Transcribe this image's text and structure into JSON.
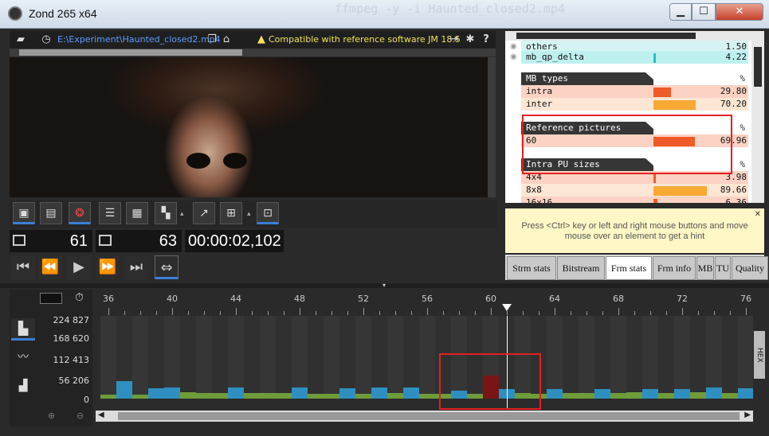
{
  "window": {
    "title": "Zond 265 x64",
    "min_label": "▁",
    "max_label": "☐",
    "close_label": "✕"
  },
  "background_code": "ffmpeg -y -i Haunted_closed2.mp4",
  "filebar": {
    "file_path": "E:\\Experiment\\Haunted_closed2.mp4",
    "compat_text": "Compatible with reference software JM 18.5"
  },
  "counters": {
    "current_frame": "61",
    "total_frames": "63",
    "timecode": "00:00:02,102"
  },
  "stats": {
    "top_rows": [
      {
        "label": "others",
        "value": "1.50"
      },
      {
        "label": "mb_qp_delta",
        "value": "4.22"
      }
    ],
    "sections": [
      {
        "title": "MB types",
        "pct": "%",
        "rows": [
          {
            "label": "intra",
            "value": "29.80",
            "fraction": 0.298,
            "color": "#f05a28"
          },
          {
            "label": "inter",
            "value": "70.20",
            "fraction": 0.702,
            "color": "#f7a934"
          }
        ]
      },
      {
        "title": "Reference pictures",
        "pct": "%",
        "rows": [
          {
            "label": "60",
            "value": "69.96",
            "fraction": 0.6996,
            "color": "#f05a28"
          }
        ]
      },
      {
        "title": "Intra PU sizes",
        "pct": "%",
        "rows": [
          {
            "label": "4x4",
            "value": "3.98",
            "fraction": 0.04,
            "color": "#f05a28"
          },
          {
            "label": "8x8",
            "value": "89.66",
            "fraction": 0.8966,
            "color": "#f7a934"
          },
          {
            "label": "16x16",
            "value": "6.36",
            "fraction": 0.06,
            "color": "#f05a28"
          }
        ]
      }
    ]
  },
  "hint": {
    "text": "Press <Ctrl> key or left and right mouse buttons and move mouse over an element to get a hint",
    "close": "✕"
  },
  "tabs": [
    {
      "label": "Strm stats",
      "active": false
    },
    {
      "label": "Bitstream",
      "active": false
    },
    {
      "label": "Frm stats",
      "active": true
    },
    {
      "label": "Frm info",
      "active": false
    },
    {
      "label": "MB",
      "active": false
    },
    {
      "label": "TU",
      "active": false
    },
    {
      "label": "Quality",
      "active": false
    }
  ],
  "timeline": {
    "y_labels": [
      "224 827",
      "168 620",
      "112 413",
      "56 206",
      "0"
    ],
    "hex_label": "HEX",
    "colors": {
      "i": "#2f8fc0",
      "p": "#6f9c3a",
      "selected": "#7a1515",
      "cursor": "#ffffff"
    }
  },
  "chart_data": {
    "type": "bar",
    "x_ticks": [
      36,
      40,
      44,
      48,
      52,
      56,
      60,
      64,
      68,
      72,
      76
    ],
    "ylim": [
      0,
      224827
    ],
    "current_frame": 61,
    "frames": [
      {
        "n": 36,
        "size": 10000,
        "kind": "p"
      },
      {
        "n": 37,
        "size": 48000,
        "kind": "i"
      },
      {
        "n": 38,
        "size": 11000,
        "kind": "p"
      },
      {
        "n": 39,
        "size": 28000,
        "kind": "i"
      },
      {
        "n": 40,
        "size": 30000,
        "kind": "i"
      },
      {
        "n": 41,
        "size": 17000,
        "kind": "p"
      },
      {
        "n": 42,
        "size": 16000,
        "kind": "p"
      },
      {
        "n": 43,
        "size": 15000,
        "kind": "p"
      },
      {
        "n": 44,
        "size": 30000,
        "kind": "i"
      },
      {
        "n": 45,
        "size": 16000,
        "kind": "p"
      },
      {
        "n": 46,
        "size": 16000,
        "kind": "p"
      },
      {
        "n": 47,
        "size": 15000,
        "kind": "p"
      },
      {
        "n": 48,
        "size": 31000,
        "kind": "i"
      },
      {
        "n": 49,
        "size": 14000,
        "kind": "p"
      },
      {
        "n": 50,
        "size": 14000,
        "kind": "p"
      },
      {
        "n": 51,
        "size": 28000,
        "kind": "i"
      },
      {
        "n": 52,
        "size": 13000,
        "kind": "p"
      },
      {
        "n": 53,
        "size": 31000,
        "kind": "i"
      },
      {
        "n": 54,
        "size": 15000,
        "kind": "p"
      },
      {
        "n": 55,
        "size": 30000,
        "kind": "i"
      },
      {
        "n": 56,
        "size": 14000,
        "kind": "p"
      },
      {
        "n": 57,
        "size": 12000,
        "kind": "p"
      },
      {
        "n": 58,
        "size": 22000,
        "kind": "i"
      },
      {
        "n": 59,
        "size": 13000,
        "kind": "p"
      },
      {
        "n": 60,
        "size": 62000,
        "kind": "selected"
      },
      {
        "n": 61,
        "size": 27000,
        "kind": "i"
      },
      {
        "n": 62,
        "size": 15000,
        "kind": "p"
      },
      {
        "n": 63,
        "size": 14000,
        "kind": "p"
      },
      {
        "n": 64,
        "size": 27000,
        "kind": "i"
      },
      {
        "n": 65,
        "size": 15000,
        "kind": "p"
      },
      {
        "n": 66,
        "size": 15000,
        "kind": "p"
      },
      {
        "n": 67,
        "size": 25000,
        "kind": "i"
      },
      {
        "n": 68,
        "size": 15000,
        "kind": "p"
      },
      {
        "n": 69,
        "size": 17000,
        "kind": "p"
      },
      {
        "n": 70,
        "size": 27000,
        "kind": "i"
      },
      {
        "n": 71,
        "size": 15000,
        "kind": "p"
      },
      {
        "n": 72,
        "size": 26000,
        "kind": "i"
      },
      {
        "n": 73,
        "size": 17000,
        "kind": "p"
      },
      {
        "n": 74,
        "size": 30000,
        "kind": "i"
      },
      {
        "n": 75,
        "size": 16000,
        "kind": "p"
      },
      {
        "n": 76,
        "size": 28000,
        "kind": "i"
      }
    ]
  }
}
